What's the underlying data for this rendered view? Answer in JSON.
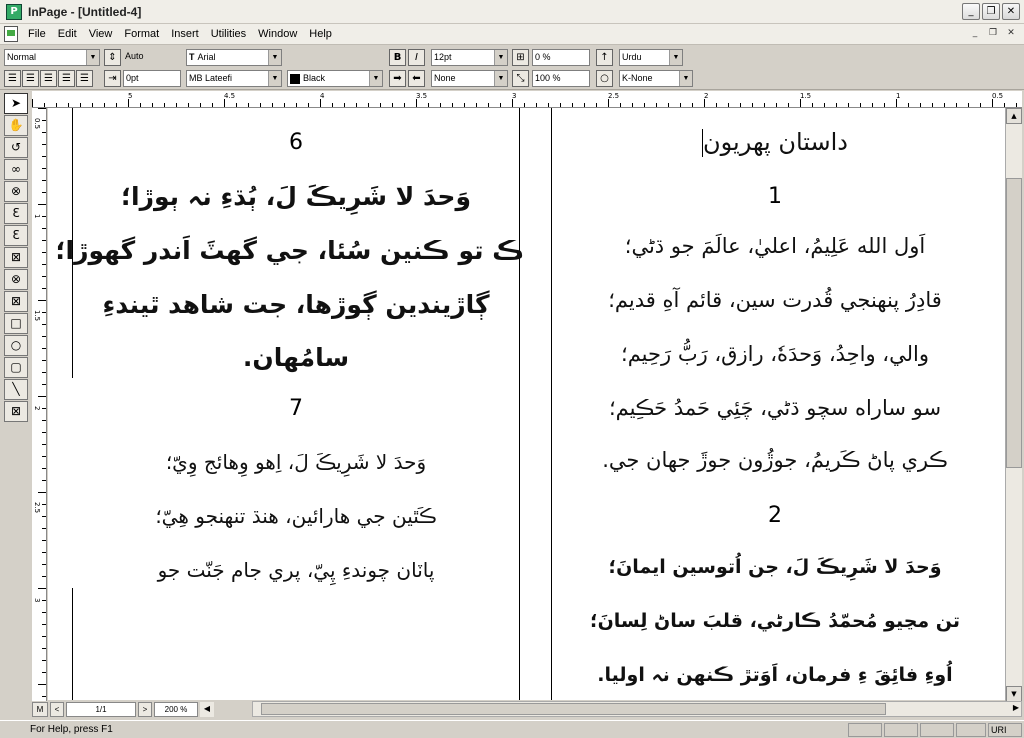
{
  "window": {
    "title": "InPage - [Untitled-4]",
    "min": "_",
    "max": "❐",
    "close": "✕"
  },
  "menu": {
    "items": [
      "File",
      "Edit",
      "View",
      "Format",
      "Insert",
      "Utilities",
      "Window",
      "Help"
    ]
  },
  "toolbar": {
    "style": "Normal",
    "leading": "Auto",
    "font_english": "Arial",
    "font_type_icon": "T",
    "bold": "B",
    "italic": "I",
    "size": "12pt",
    "tracking": "0 %",
    "language": "Urdu",
    "indent": "0pt",
    "font_urdu": "MB Lateefi",
    "color_name": "Black",
    "shade": "None",
    "scale": "100 %",
    "kerning": "K-None"
  },
  "ruler": {
    "labels": [
      "5",
      "4.5",
      "4",
      "3.5",
      "3",
      "2.5",
      "2",
      "1.5",
      "1",
      "0.5"
    ],
    "v_labels": [
      "0.5",
      "1",
      "1.5",
      "2",
      "2.5",
      "3"
    ]
  },
  "document": {
    "left_column": {
      "n6": "6",
      "s6": [
        "وَحدَ لا شَرِيڪَ لَ، ٻُڌءِ نہ ٻوڙا؛",
        "ڪ تو ڪنين سُئا، جي گهٽَ اَندر گهوڙا؛",
        "ڳاڙيندين ڳوڙها، جت شاهد ٿيندءِ",
        "سامُهان."
      ],
      "n7": "7",
      "s7": [
        "وَحدَ لا شَرِيڪَ لَ، اِهو وِهائج وِيّ؛",
        "ڪَٿين جي هارائين، هنڌ تنهنجو هِيّ؛",
        "پاٽان چوندءِ پِيّ، پري جام جَنّت جو"
      ]
    },
    "right_column": {
      "title": "داستان پهريون",
      "n1": "1",
      "s1": [
        "اَول الله عَلِيمُ، اعليٰ، عالَمَ جو ڌڻي؛",
        "قادِرُ پنهنجي قُدرت سين، قائم آهِ قديم؛",
        "والي، واحِدُ، وَحدَهٗ، رازق، رَبُّ رَحِيم؛",
        "سو ساراه سچو ڌڻي، چَئِي حَمدُ حَڪِيم؛",
        "ڪري پاڻ ڪَريمُ، جوڙُون جوڙَ جهان جي."
      ],
      "n2": "2",
      "s2": [
        "وَحدَ لا شَرِيڪَ لَ، جن اُتوسين ايمانَ؛",
        "تن مڃيو مُحمّدُ ڪارڻي، قلبَ ساڻ لِسانَ؛",
        "اُوءِ فائِقَ ءِ فرمان، اَوَتڙ ڪنهن نہ اوليا."
      ]
    }
  },
  "nav": {
    "master": "M",
    "prev": "<",
    "page": "1/1",
    "next": ">",
    "zoom": "200 %"
  },
  "status": {
    "help": "For Help, press F1",
    "lang": "URI"
  }
}
